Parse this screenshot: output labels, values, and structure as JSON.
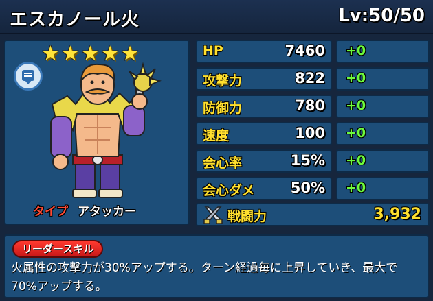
{
  "header": {
    "name": "エスカノール火",
    "level": "Lv:50/50"
  },
  "portrait": {
    "stars": 5,
    "type_label": "タイプ",
    "type_value": "アタッカー",
    "icons": [
      "chat-icon",
      "star-icon"
    ]
  },
  "stats": [
    {
      "label": "HP",
      "value": "7460",
      "bonus": "+0"
    },
    {
      "label": "攻撃力",
      "value": "822",
      "bonus": "+0"
    },
    {
      "label": "防御力",
      "value": "780",
      "bonus": "+0"
    },
    {
      "label": "速度",
      "value": "100",
      "bonus": "+0"
    },
    {
      "label": "会心率",
      "value": "15%",
      "bonus": "+0"
    },
    {
      "label": "会心ダメ",
      "value": "50%",
      "bonus": "+0"
    }
  ],
  "power": {
    "label": "戦闘力",
    "value": "3,932",
    "icon": "crossed-swords-icon"
  },
  "skill": {
    "badge": "リーダースキル",
    "text": "火属性の攻撃力が30%アップする。ターン経過毎に上昇していき、最大で70%アップする。"
  },
  "colors": {
    "stat_label": "#ffe02e",
    "bonus": "#6dfa3d",
    "type_label": "#ff4a34",
    "panel": "#1d4e79"
  }
}
